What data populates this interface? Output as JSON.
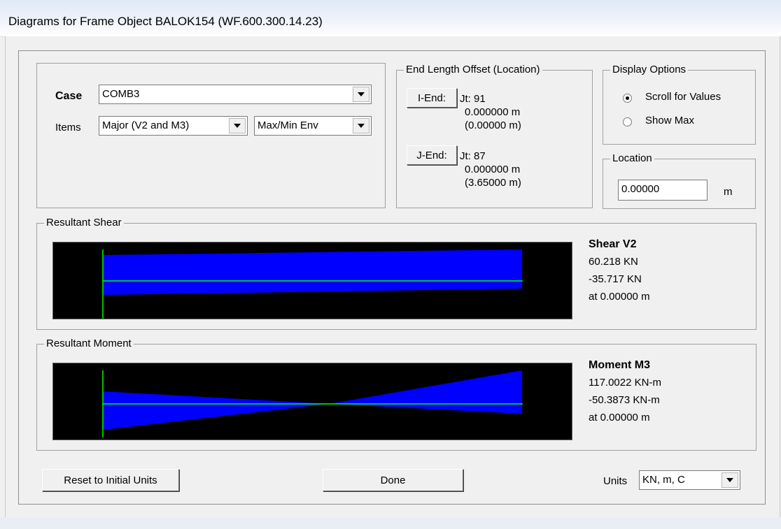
{
  "window": {
    "title": "Diagrams for Frame Object BALOK154  (WF.600.300.14.23)"
  },
  "case": {
    "label": "Case",
    "value": "COMB3",
    "items_label": "Items",
    "items_value": "Major (V2 and M3)",
    "envelope_value": "Max/Min Env"
  },
  "end_offset": {
    "caption": "End Length Offset (Location)",
    "i_end": {
      "button": "I-End:",
      "joint": "Jt:  91",
      "offset": "0.000000 m",
      "location": "(0.00000 m)"
    },
    "j_end": {
      "button": "J-End:",
      "joint": "Jt:  87",
      "offset": "0.000000 m",
      "location": "(3.65000 m)"
    }
  },
  "display_options": {
    "caption": "Display Options",
    "options": [
      {
        "label": "Scroll for Values",
        "selected": true
      },
      {
        "label": "Show Max",
        "selected": false
      }
    ]
  },
  "location": {
    "caption": "Location",
    "value": "0.00000",
    "unit": "m"
  },
  "shear": {
    "caption": "Resultant Shear",
    "heading": "Shear V2",
    "max": "60.218 KN",
    "min": "-35.717 KN",
    "at": "at 0.00000 m"
  },
  "moment": {
    "caption": "Resultant Moment",
    "heading": "Moment M3",
    "max": "117.0022 KN-m",
    "min": "-50.3873 KN-m",
    "at": "at 0.00000 m"
  },
  "footer": {
    "reset_button": "Reset to Initial Units",
    "done_button": "Done",
    "units_label": "Units",
    "units_value": "KN, m, C"
  },
  "colors": {
    "diagram_fill": "#0000ff",
    "axis_line": "#00ff00",
    "plot_background": "#000000"
  }
}
